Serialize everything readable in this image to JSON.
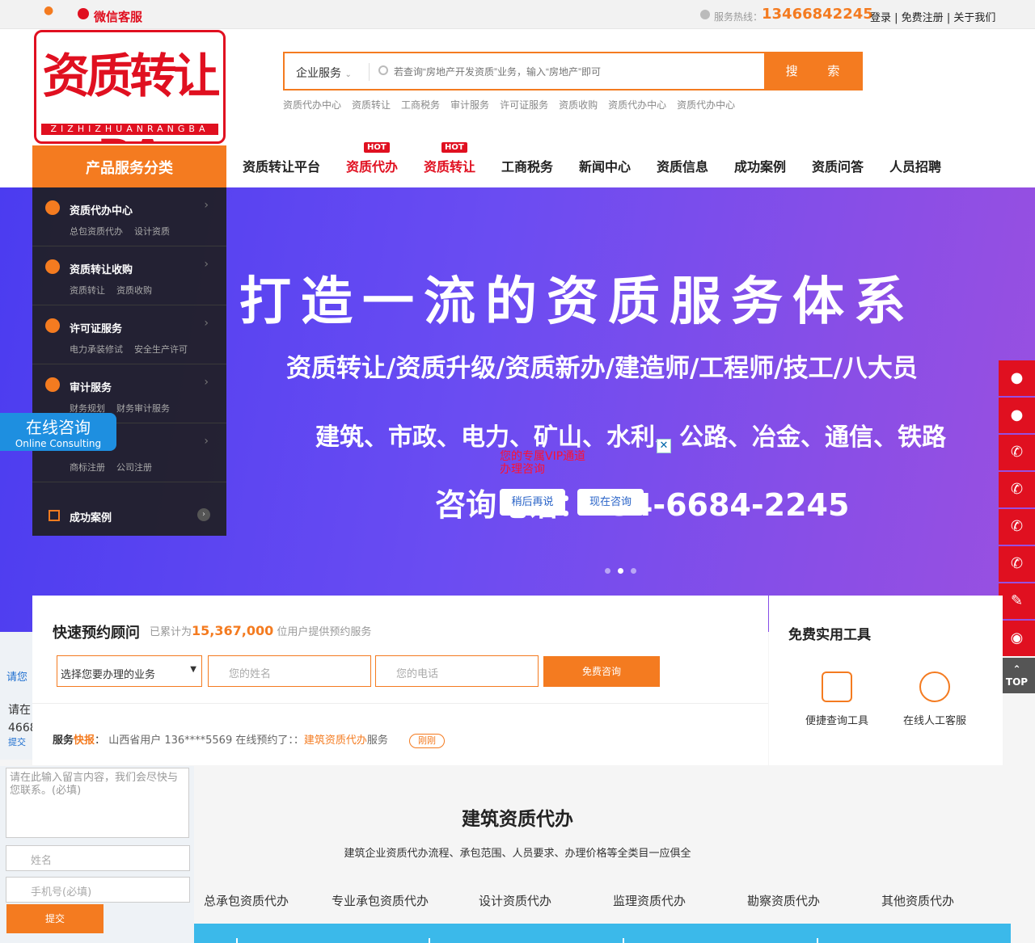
{
  "topbar": {
    "wechat": "微信客服",
    "hotline_label": "服务热线：",
    "hotline": "13466842245",
    "links": [
      "登录",
      "免费注册",
      "关于我们"
    ]
  },
  "logo": {
    "text": "资质转让BA",
    "sub": "ZIZHIZHUANRANGBA"
  },
  "search": {
    "category": "企业服务",
    "placeholder": "若查询“房地产开发资质”业务，输入“房地产”即可",
    "button": "搜 索",
    "hotwords": [
      "资质代办中心",
      "资质转让",
      "工商税务",
      "审计服务",
      "许可证服务",
      "资质收购",
      "资质代办中心",
      "资质代办中心"
    ]
  },
  "category_header": "产品服务分类",
  "nav": [
    {
      "label": "资质转让平台",
      "hot": ""
    },
    {
      "label": "资质代办",
      "hot": "HOT"
    },
    {
      "label": "资质转让",
      "hot": "HOT"
    },
    {
      "label": "工商税务",
      "hot": ""
    },
    {
      "label": "新闻中心",
      "hot": ""
    },
    {
      "label": "资质信息",
      "hot": ""
    },
    {
      "label": "成功案例",
      "hot": ""
    },
    {
      "label": "资质问答",
      "hot": ""
    },
    {
      "label": "人员招聘",
      "hot": ""
    }
  ],
  "categories": [
    {
      "title": "资质代办中心",
      "subs": [
        "总包资质代办",
        "设计资质"
      ]
    },
    {
      "title": "资质转让收购",
      "subs": [
        "资质转让",
        "资质收购"
      ]
    },
    {
      "title": "许可证服务",
      "subs": [
        "电力承装修试",
        "安全生产许可"
      ]
    },
    {
      "title": "审计服务",
      "subs": [
        "财务规划",
        "财务审计服务"
      ]
    },
    {
      "title": "",
      "subs": [
        "商标注册",
        "公司注册"
      ]
    }
  ],
  "success_cases": "成功案例",
  "banner": {
    "line1": "打造一流的资质服务体系",
    "line2": "资质转让/资质升级/资质新办/建造师/工程师/技工/八大员",
    "line3": "建筑、市政、电力、矿山、水利、公路、冶金、通信、铁路",
    "line4": "咨询电话：134-6684-2245"
  },
  "online_consult": {
    "cn": "在线咨询",
    "en": "Online Consulting"
  },
  "vip_popup": {
    "text1": "您的专属VIP通道",
    "text2": "办理咨询",
    "later": "稍后再说",
    "now": "现在咨询"
  },
  "side_buttons": [
    "qq",
    "qq",
    "phone",
    "phone",
    "phone",
    "phone",
    "form",
    "wechat"
  ],
  "top_label": "TOP",
  "left_stub": {
    "a": "请您",
    "b": "请在",
    "c": "4668",
    "d": "提交"
  },
  "booking": {
    "title": "快速预约顾问",
    "sub_pre": "已累计为",
    "count": "15,367,000",
    "sub_post": "位用户提供预约服务",
    "select": "选择您要办理的业务",
    "name_ph": "您的姓名",
    "phone_ph": "您的电话",
    "button": "免费咨询",
    "news_label1": "服务",
    "news_label2": "快报",
    "news_text": "山西省用户 136****5569 在线预约了：：",
    "news_item": "建筑资质代办",
    "news_suffix": "服务",
    "news_tag": "刚刚"
  },
  "tools": {
    "title": "免费实用工具",
    "items": [
      "便捷查询工具",
      "在线人工客服"
    ]
  },
  "message_form": {
    "textarea": "请在此输入留言内容，我们会尽快与您联系。(必填)",
    "name_ph": "姓名",
    "phone_ph": "手机号(必填)",
    "submit": "提交"
  },
  "section": {
    "title": "建筑资质代办",
    "desc": "建筑企业资质代办流程、承包范围、人员要求、办理价格等全类目一应俱全",
    "tabs": [
      "总承包资质代办",
      "专业承包资质代办",
      "设计资质代办",
      "监理资质代办",
      "勘察资质代办",
      "其他资质代办"
    ]
  }
}
